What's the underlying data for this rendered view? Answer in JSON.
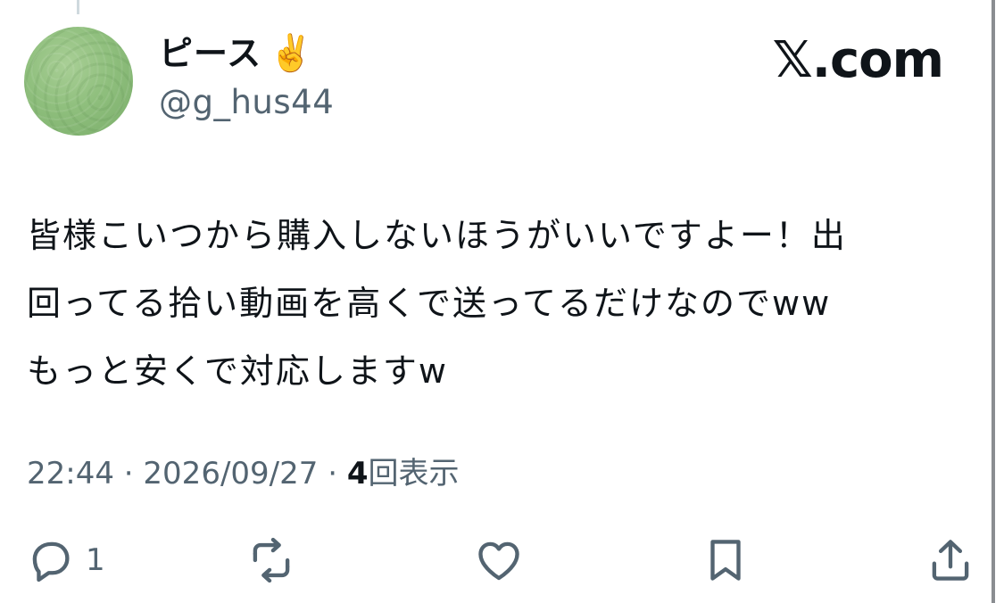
{
  "author": {
    "display_name": "ピース",
    "emoji": "✌️",
    "handle": "@g_hus44"
  },
  "brand": {
    "label": "𝕏.com"
  },
  "post": {
    "text": "皆様こいつから購入しないほうがいいですよー！出\n回ってる拾い動画を高くで送ってるだけなのでww\nもっと安くで対応しますw"
  },
  "meta": {
    "time": "22:44",
    "separator": "·",
    "date": "2026/09/27",
    "views_count": "4",
    "views_label": "回表示"
  },
  "actions": {
    "reply_count": "1",
    "icons": [
      "reply-icon",
      "repost-icon",
      "like-icon",
      "bookmark-icon",
      "share-icon"
    ]
  },
  "colors": {
    "text_primary": "#0f1419",
    "text_secondary": "#536471",
    "avatar": "#8fbf7d"
  }
}
